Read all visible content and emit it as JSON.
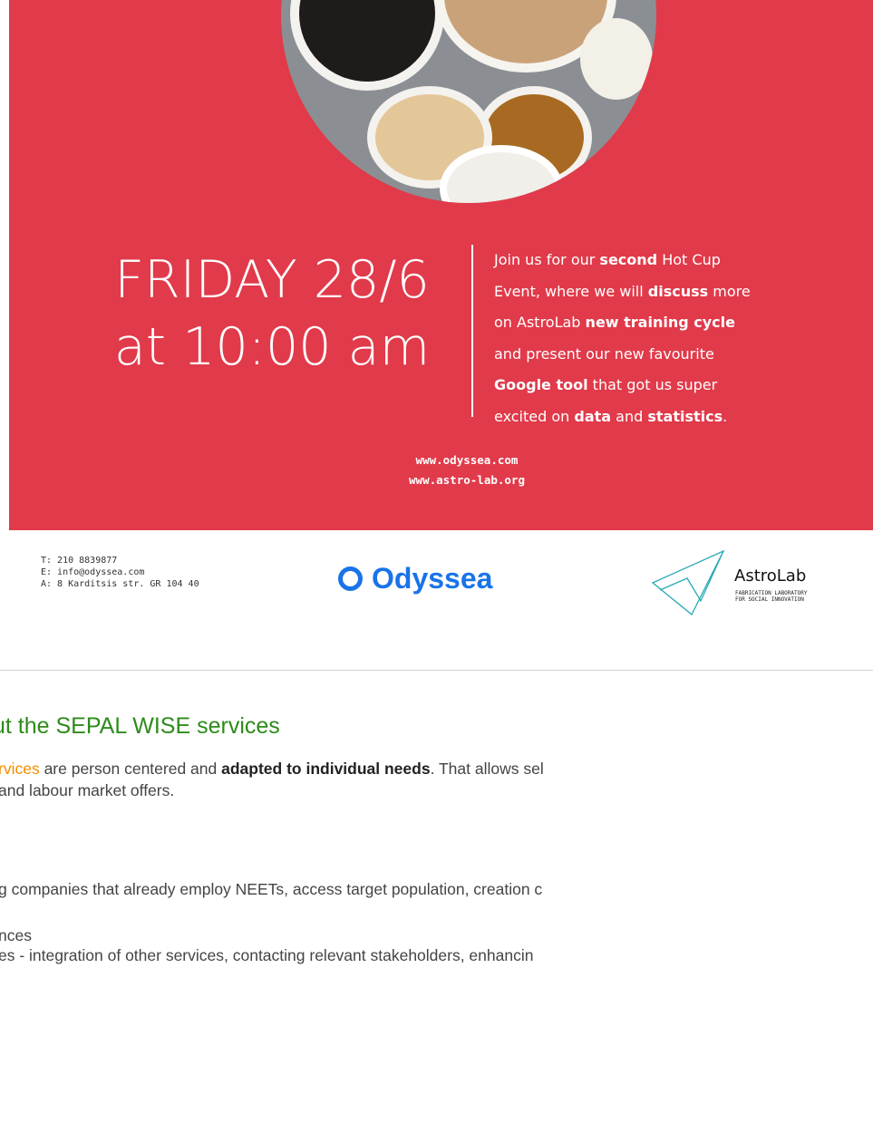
{
  "poster": {
    "date_line1": "FRIDAY 28/6",
    "date_line2": "at 10:00 am",
    "blurb": [
      [
        {
          "t": "Join us for our ",
          "b": false
        },
        {
          "t": "second",
          "b": true
        },
        {
          "t": " Hot Cup",
          "b": false
        }
      ],
      [
        {
          "t": "Event, where we will ",
          "b": false
        },
        {
          "t": "discuss",
          "b": true
        },
        {
          "t": " more",
          "b": false
        }
      ],
      [
        {
          "t": "on AstroLab ",
          "b": false
        },
        {
          "t": "new training cycle",
          "b": true
        }
      ],
      [
        {
          "t": "and present our new favourite",
          "b": false
        }
      ],
      [
        {
          "t": "Google tool",
          "b": true
        },
        {
          "t": " that got us super",
          "b": false
        }
      ],
      [
        {
          "t": "excited on ",
          "b": false
        },
        {
          "t": "data",
          "b": true
        },
        {
          "t": " and ",
          "b": false
        },
        {
          "t": "statistics",
          "b": true
        },
        {
          "t": ".",
          "b": false
        }
      ]
    ],
    "url1": "www.odyssea.com",
    "url2": "www.astro-lab.org",
    "background_color": "#e13a4a"
  },
  "footer": {
    "phone": "T: 210 8839877",
    "email": "E: info@odyssea.com",
    "address": "A: 8 Karditsis str. GR 104 40",
    "odyssea_logo_text": "Odyssea",
    "astrolab_name": "AstroLab",
    "astrolab_sub1": "FABRICATION LABORATORY",
    "astrolab_sub2": "FOR SOCIAL INNOVATION"
  },
  "article": {
    "title": "ut the SEPAL WISE services",
    "p1_a": "rvices",
    "p1_b": " are person centered and ",
    "p1_c": "adapted to individual needs",
    "p1_d": ". That allows sel",
    "p1_line2": " and labour market offers.",
    "line3": "g companies that already employ NEETs, access target population, creation c",
    "line4": "nces",
    "line5": "es - integration of other services, contacting relevant stakeholders, enhancin"
  }
}
